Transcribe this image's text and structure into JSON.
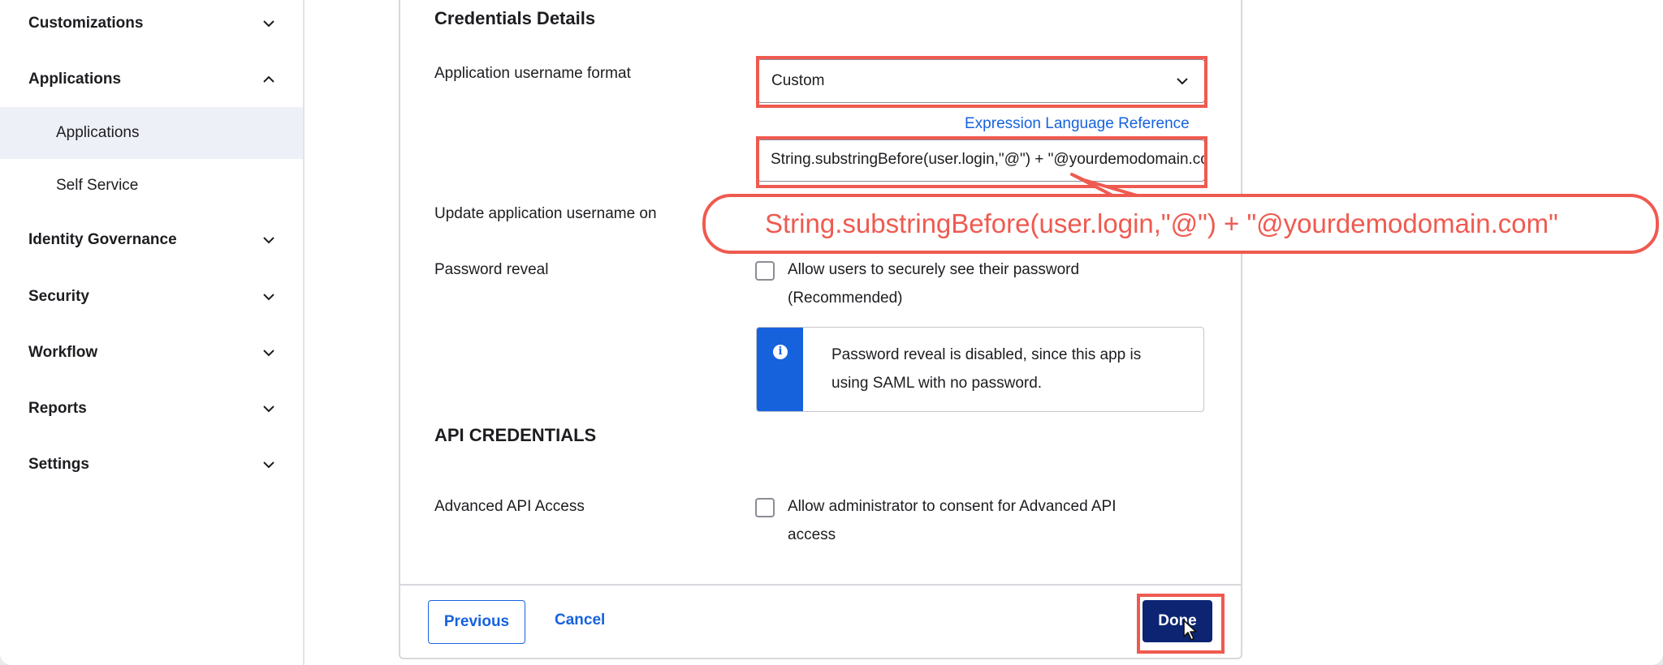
{
  "sidebar": {
    "sections": [
      {
        "label": "Customizations",
        "expanded": false
      },
      {
        "label": "Applications",
        "expanded": true
      },
      {
        "label": "Identity Governance",
        "expanded": false
      },
      {
        "label": "Security",
        "expanded": false
      },
      {
        "label": "Workflow",
        "expanded": false
      },
      {
        "label": "Reports",
        "expanded": false
      },
      {
        "label": "Settings",
        "expanded": false
      }
    ],
    "sub_items": [
      {
        "label": "Applications",
        "active": true
      },
      {
        "label": "Self Service",
        "active": false
      }
    ]
  },
  "form": {
    "section_title": "Credentials Details",
    "username_format": {
      "label": "Application username format",
      "value": "Custom"
    },
    "expression_link": "Expression Language Reference",
    "expression_value": "String.substringBefore(user.login,\"@\") + \"@yourdemodomain.com\"",
    "update_on_label": "Update application username on",
    "password_reveal": {
      "label": "Password reveal",
      "checkbox_text": "Allow users to securely see their password (Recommended)",
      "checked": false,
      "info_message": "Password reveal is disabled, since this app is using SAML with no password."
    },
    "api_section_title": "API CREDENTIALS",
    "advanced_api": {
      "label": "Advanced API Access",
      "checkbox_text": "Allow administrator to consent for Advanced API access",
      "checked": false
    }
  },
  "footer": {
    "previous_label": "Previous",
    "cancel_label": "Cancel",
    "done_label": "Done"
  },
  "annotation": {
    "callout_text": "String.substringBefore(user.login,\"@\") + \"@yourdemodomain.com\""
  },
  "colors": {
    "accent_blue": "#1662dd",
    "done_button": "#0d2473",
    "highlight_red": "#ef5a50",
    "active_nav_bg": "#eef0f8"
  },
  "icons": [
    "chevron-down-icon",
    "chevron-up-icon",
    "info-icon",
    "mouse-cursor-icon"
  ]
}
